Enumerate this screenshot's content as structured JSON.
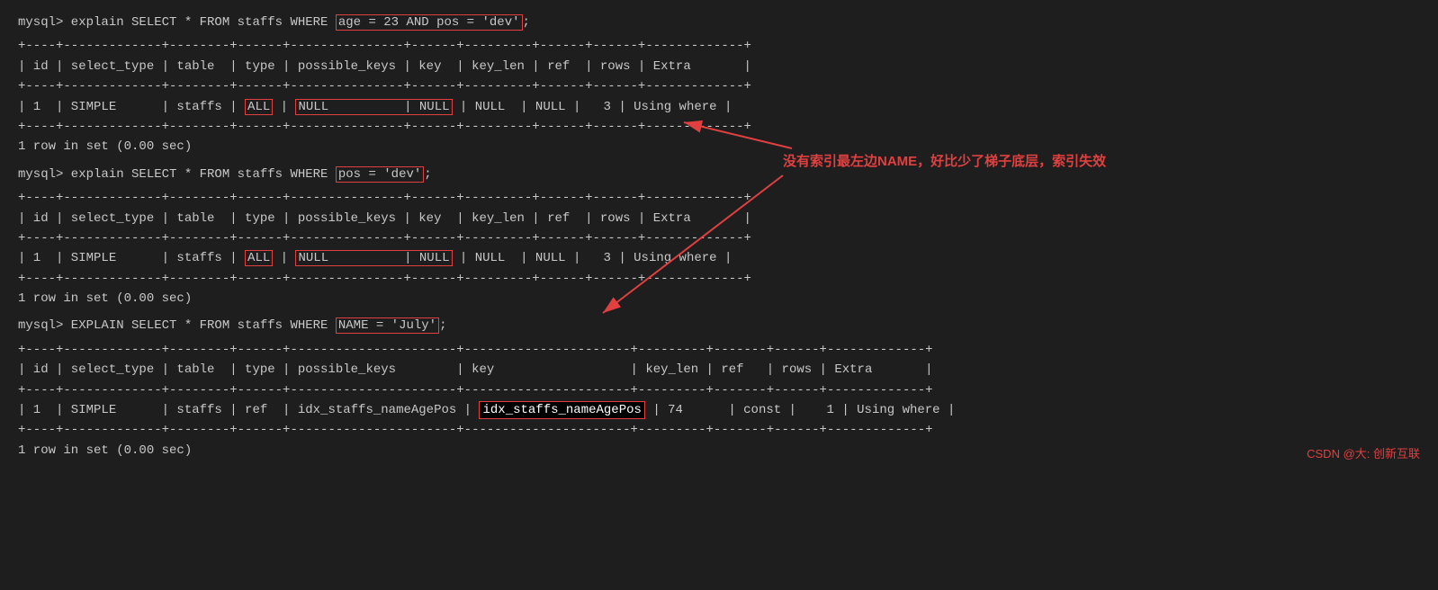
{
  "terminal": {
    "line1_prompt": "mysql> explain SELECT * FROM staffs WHERE ",
    "line1_highlight": "age = 23 AND pos = 'dev'",
    "line1_end": ";",
    "table1_separator1": "+----+-------------+--------+------+---------------+------+---------+------+------+-------------+",
    "table1_header": "| id | select_type | table  | type | possible_keys | key  | key_len | ref  | rows | Extra       |",
    "table1_separator2": "+----+-------------+--------+------+---------------+------+---------+------+------+-------------+",
    "table1_row_pre": "| 1  | SIMPLE      | staffs | ",
    "table1_row_box1": "ALL",
    "table1_row_mid": " | ",
    "table1_row_box2": "NULL          | NULL",
    "table1_row_post": " | NULL  | NULL |   3 | Using where |",
    "table1_separator3": "+----+-------------+--------+------+---------------+------+---------+------+------+-------------+",
    "rowset1": "1 row in set (0.00 sec)",
    "line2_prompt": "mysql> explain SELECT * FROM staffs WHERE ",
    "line2_highlight": "pos = 'dev'",
    "line2_end": ";",
    "table2_separator1": "+----+-------------+--------+------+---------------+------+---------+------+------+-------------+",
    "table2_header": "| id | select_type | table  | type | possible_keys | key  | key_len | ref  | rows | Extra       |",
    "table2_separator2": "+----+-------------+--------+------+---------------+------+---------+------+------+-------------+",
    "table2_row_pre": "| 1  | SIMPLE      | staffs | ",
    "table2_row_box1": "ALL",
    "table2_row_mid": " | ",
    "table2_row_box2": "NULL          | NULL",
    "table2_row_post": " | NULL  | NULL |   3 | Using where |",
    "table2_separator3": "+----+-------------+--------+------+---------------+------+---------+------+------+-------------+",
    "rowset2": "1 row in set (0.00 sec)",
    "line3_prompt": "mysql> EXPLAIN SELECT * FROM staffs WHERE ",
    "line3_highlight": "NAME = 'July'",
    "line3_end": ";",
    "table3_separator1": "+----+-------------+--------+------+----------------------+----------------------+---------+-------+------+-------------+",
    "table3_header": "| id | select_type | table  | type | possible_keys        | key                  | key_len | ref   | rows | Extra       |",
    "table3_separator2": "+----+-------------+--------+------+----------------------+----------------------+---------+-------+------+-------------+",
    "table3_row_pre": "| 1  | SIMPLE      | staffs | ref  | idx_staffs_nameAgePos | ",
    "table3_row_keybox": "idx_staffs_nameAgePos",
    "table3_row_post": " | 74      | const |    1 | Using where |",
    "table3_separator3": "+----+-------------+--------+------+----------------------+----------------------+---------+-------+------+-------------+",
    "rowset3": "1 row in set (0.00 sec)",
    "annotation_text": "没有索引最左边NAME，好比少了梯子底层，索引失效",
    "footer_text": "CSDN @大: 创新互联"
  }
}
